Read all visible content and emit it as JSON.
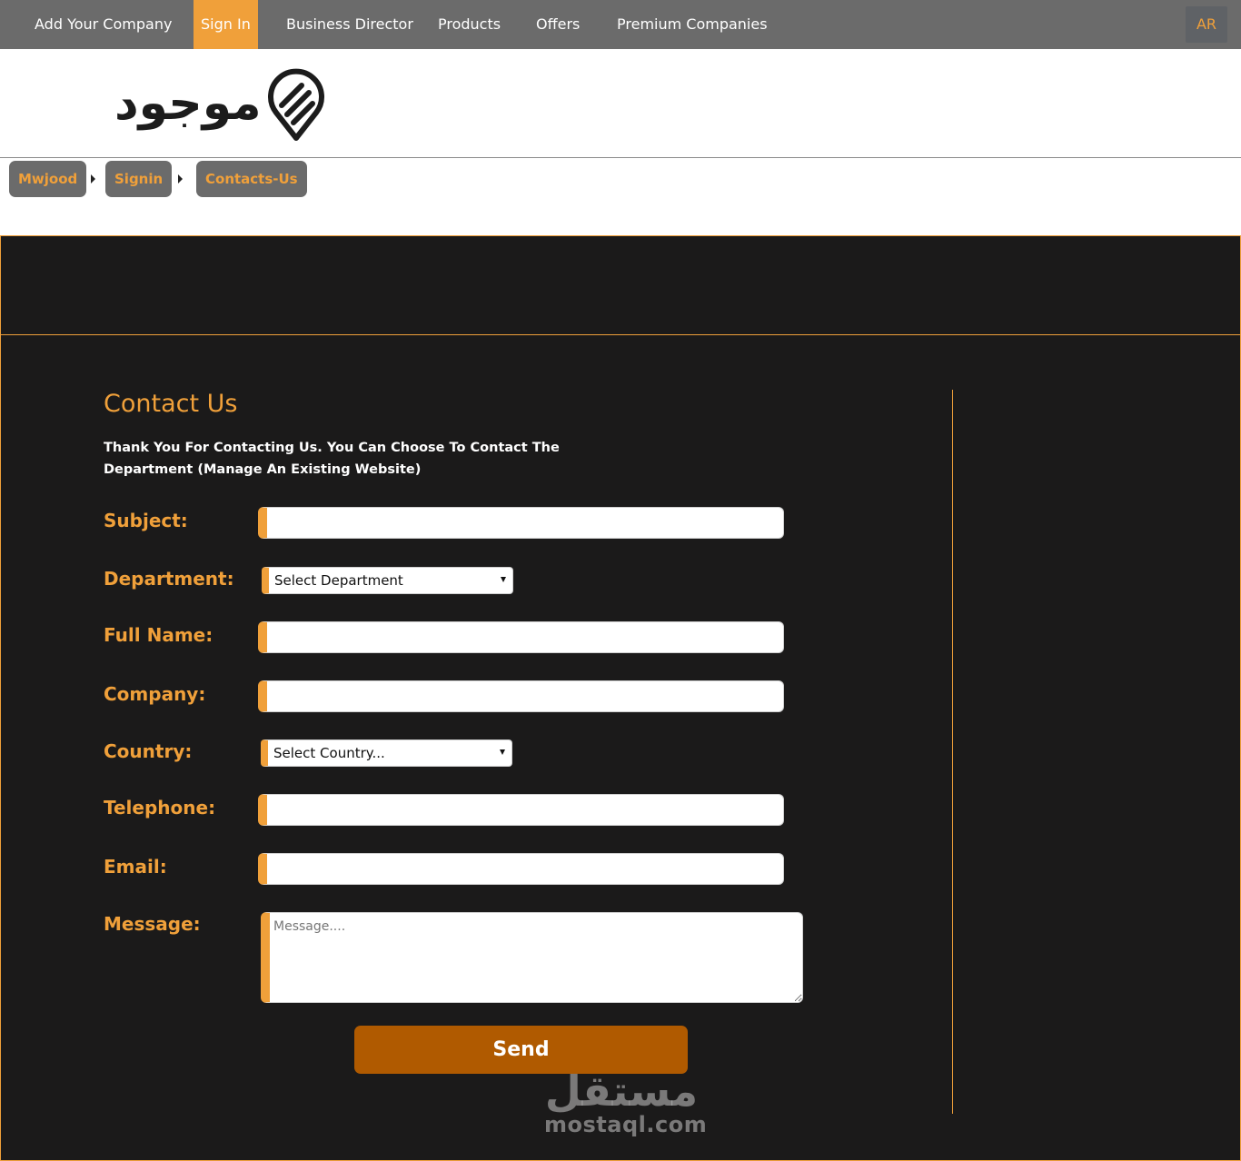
{
  "nav": {
    "items": [
      {
        "label": "Add Your Company"
      },
      {
        "label": "Sign In"
      },
      {
        "label": "Business Director"
      },
      {
        "label": "Products"
      },
      {
        "label": "Offers"
      },
      {
        "label": "Premium Companies"
      }
    ],
    "lang": "AR"
  },
  "logo": {
    "text": "موجود"
  },
  "breadcrumb": [
    "Mwjood",
    "Signin",
    "Contacts-Us"
  ],
  "form": {
    "title": "Contact Us",
    "intro": "Thank You For Contacting Us. You Can Choose To Contact The Department (Manage An Existing Website)",
    "labels": {
      "subject": "Subject:",
      "department": "Department:",
      "full_name": "Full Name:",
      "company": "Company:",
      "country": "Country:",
      "telephone": "Telephone:",
      "email": "Email:",
      "message": "Message:"
    },
    "department_selected": "Select Department",
    "country_selected": "Select Country...",
    "message_placeholder": "Message....",
    "send_label": "Send"
  },
  "watermark": {
    "ar": "مستقل",
    "en": "mostaql.com"
  },
  "colors": {
    "accent": "#f0a03a",
    "dark_bg": "#1b1a1a",
    "nav_bg": "#6b6b6b",
    "send_bg": "#b05a00"
  }
}
